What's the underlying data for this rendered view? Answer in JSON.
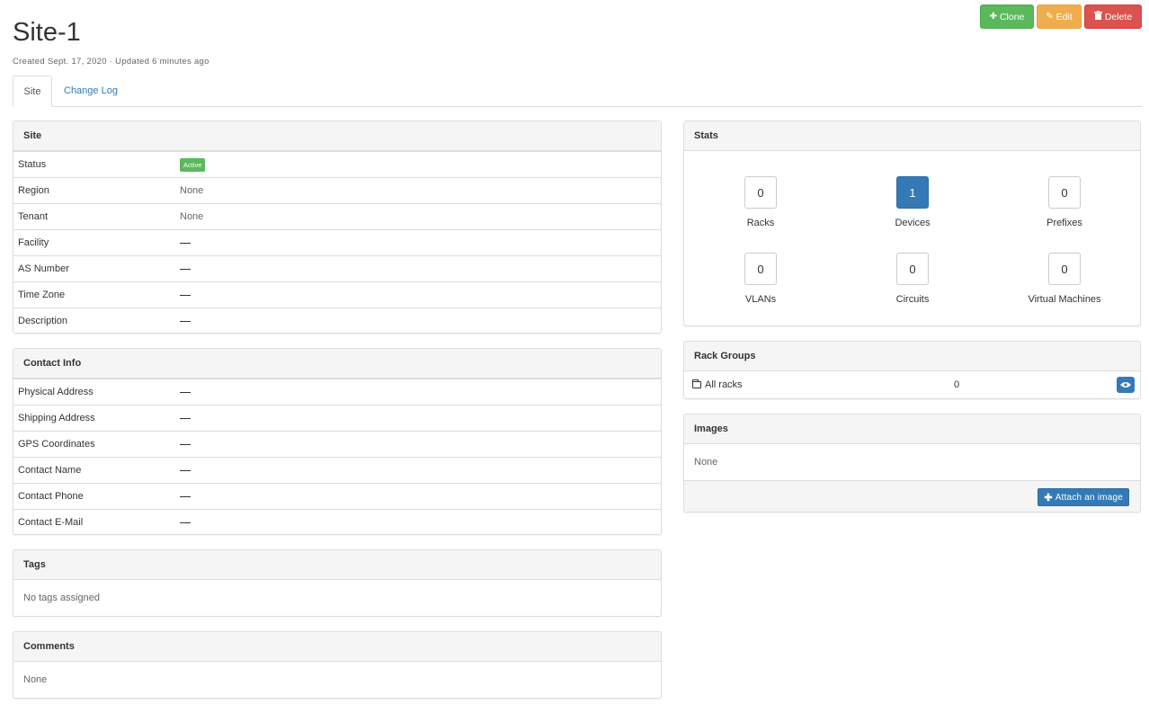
{
  "header": {
    "title": "Site-1",
    "subtitle": "Created Sept. 17, 2020 · Updated 6 minutes ago"
  },
  "actions": {
    "clone": "Clone",
    "edit": "Edit",
    "delete": "Delete"
  },
  "tabs": [
    {
      "label": "Site"
    },
    {
      "label": "Change Log"
    }
  ],
  "site_panel": {
    "title": "Site",
    "status_label": "Status",
    "status_value": "Active",
    "rows": [
      {
        "label": "Region",
        "value": "None"
      },
      {
        "label": "Tenant",
        "value": "None"
      },
      {
        "label": "Facility",
        "value": ""
      },
      {
        "label": "AS Number",
        "value": ""
      },
      {
        "label": "Time Zone",
        "value": ""
      },
      {
        "label": "Description",
        "value": ""
      }
    ]
  },
  "contact_panel": {
    "title": "Contact Info",
    "rows": [
      {
        "label": "Physical Address",
        "value": ""
      },
      {
        "label": "Shipping Address",
        "value": ""
      },
      {
        "label": "GPS Coordinates",
        "value": ""
      },
      {
        "label": "Contact Name",
        "value": ""
      },
      {
        "label": "Contact Phone",
        "value": ""
      },
      {
        "label": "Contact E-Mail",
        "value": ""
      }
    ]
  },
  "tags_panel": {
    "title": "Tags",
    "body": "No tags assigned"
  },
  "comments_panel": {
    "title": "Comments",
    "body": "None"
  },
  "stats_panel": {
    "title": "Stats",
    "items": [
      {
        "label": "Racks",
        "value": "0"
      },
      {
        "label": "Devices",
        "value": "1"
      },
      {
        "label": "Prefixes",
        "value": "0"
      },
      {
        "label": "VLANs",
        "value": "0"
      },
      {
        "label": "Circuits",
        "value": "0"
      },
      {
        "label": "Virtual Machines",
        "value": "0"
      }
    ]
  },
  "rack_groups_panel": {
    "title": "Rack Groups",
    "rows": [
      {
        "label": "All racks",
        "count": "0"
      }
    ]
  },
  "images_panel": {
    "title": "Images",
    "body": "None",
    "attach_label": "Attach an image"
  },
  "colors": {
    "success": "#5cb85c",
    "warning": "#f0ad4e",
    "danger": "#d9534f",
    "primary": "#337ab7"
  }
}
